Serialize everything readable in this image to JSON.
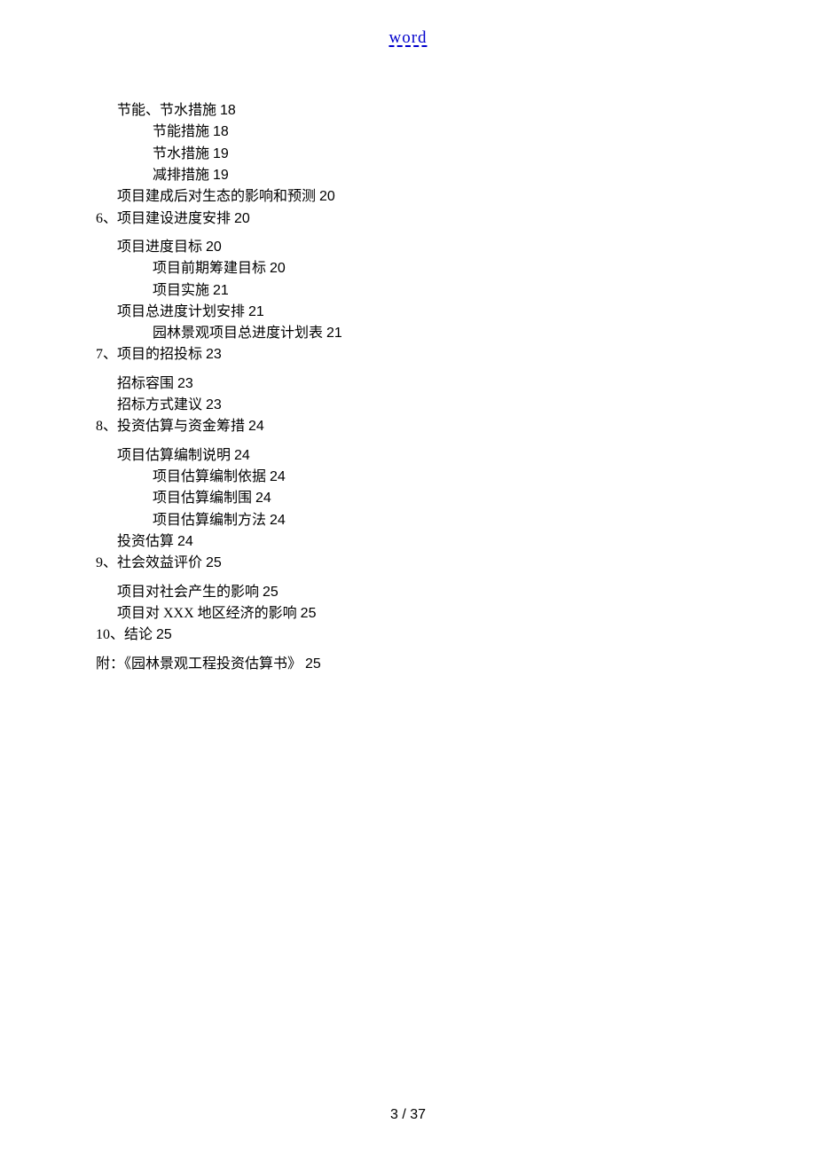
{
  "header": {
    "word_label": "word"
  },
  "toc": [
    {
      "text": "节能、节水措施",
      "page": "18",
      "indent": 1,
      "gap": false
    },
    {
      "text": "节能措施",
      "page": "18",
      "indent": 2,
      "gap": false
    },
    {
      "text": "节水措施",
      "page": "19",
      "indent": 2,
      "gap": false
    },
    {
      "text": "减排措施",
      "page": "19",
      "indent": 2,
      "gap": false
    },
    {
      "text": "项目建成后对生态的影响和预测",
      "page": "20",
      "indent": 1,
      "gap": false
    },
    {
      "text": "6、项目建设进度安排",
      "page": "20",
      "indent": 0,
      "gap": false
    },
    {
      "text": "项目进度目标",
      "page": "20",
      "indent": 1,
      "gap": true
    },
    {
      "text": "项目前期筹建目标",
      "page": "20",
      "indent": 2,
      "gap": false
    },
    {
      "text": "项目实施",
      "page": "21",
      "indent": 2,
      "gap": false
    },
    {
      "text": "项目总进度计划安排",
      "page": "21",
      "indent": 1,
      "gap": false
    },
    {
      "text": "园林景观项目总进度计划表",
      "page": "21",
      "indent": 2,
      "gap": false
    },
    {
      "text": "7、项目的招投标",
      "page": "23",
      "indent": 0,
      "gap": false
    },
    {
      "text": "招标容围",
      "page": "23",
      "indent": 1,
      "gap": true
    },
    {
      "text": "招标方式建议",
      "page": "23",
      "indent": 1,
      "gap": false
    },
    {
      "text": "8、投资估算与资金筹措",
      "page": "24",
      "indent": 0,
      "gap": false
    },
    {
      "text": "项目估算编制说明",
      "page": "24",
      "indent": 1,
      "gap": true
    },
    {
      "text": "项目估算编制依据",
      "page": "24",
      "indent": 2,
      "gap": false
    },
    {
      "text": "项目估算编制围",
      "page": "24",
      "indent": 2,
      "gap": false
    },
    {
      "text": "项目估算编制方法",
      "page": "24",
      "indent": 2,
      "gap": false
    },
    {
      "text": "投资估算",
      "page": "24",
      "indent": 1,
      "gap": false
    },
    {
      "text": "9、社会效益评价",
      "page": "25",
      "indent": 0,
      "gap": false
    },
    {
      "text": "项目对社会产生的影响",
      "page": "25",
      "indent": 1,
      "gap": true
    },
    {
      "text": "项目对 XXX 地区经济的影响",
      "page": "25",
      "indent": 1,
      "gap": false
    },
    {
      "text": "10、结论",
      "page": "25",
      "indent": 0,
      "gap": false
    },
    {
      "text": "附：《园林景观工程投资估算书》",
      "page": "25",
      "indent": 0,
      "gap": true
    }
  ],
  "footer": {
    "page_current": "3",
    "page_separator": " / ",
    "page_total": "37"
  }
}
